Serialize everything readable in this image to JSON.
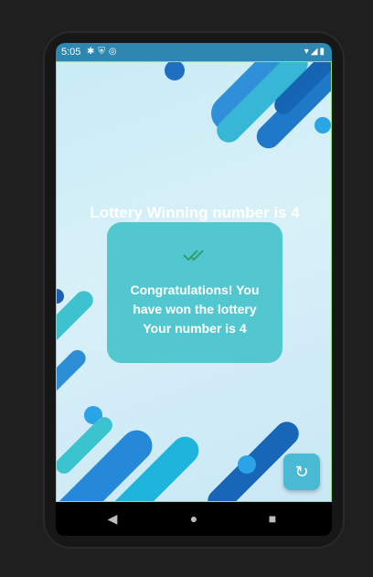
{
  "status_bar": {
    "time": "5:05",
    "left_icons": [
      "gear-icon",
      "shield-icon",
      "sync-icon"
    ],
    "right_icons": [
      "wifi-icon",
      "signal-icon",
      "battery-icon"
    ]
  },
  "main": {
    "headline": "Lottery Winning number is 4",
    "card": {
      "icon": "double-check-icon",
      "line1": "Congratulations! You",
      "line2": "have won the lottery",
      "line3": "Your number is 4"
    },
    "fab_icon": "refresh-icon"
  },
  "nav_bar": {
    "back": "◀",
    "home": "●",
    "recents": "■"
  },
  "colors": {
    "accent": "#4ab9d4",
    "card": "#53c7cf",
    "check": "#2e9f74"
  }
}
